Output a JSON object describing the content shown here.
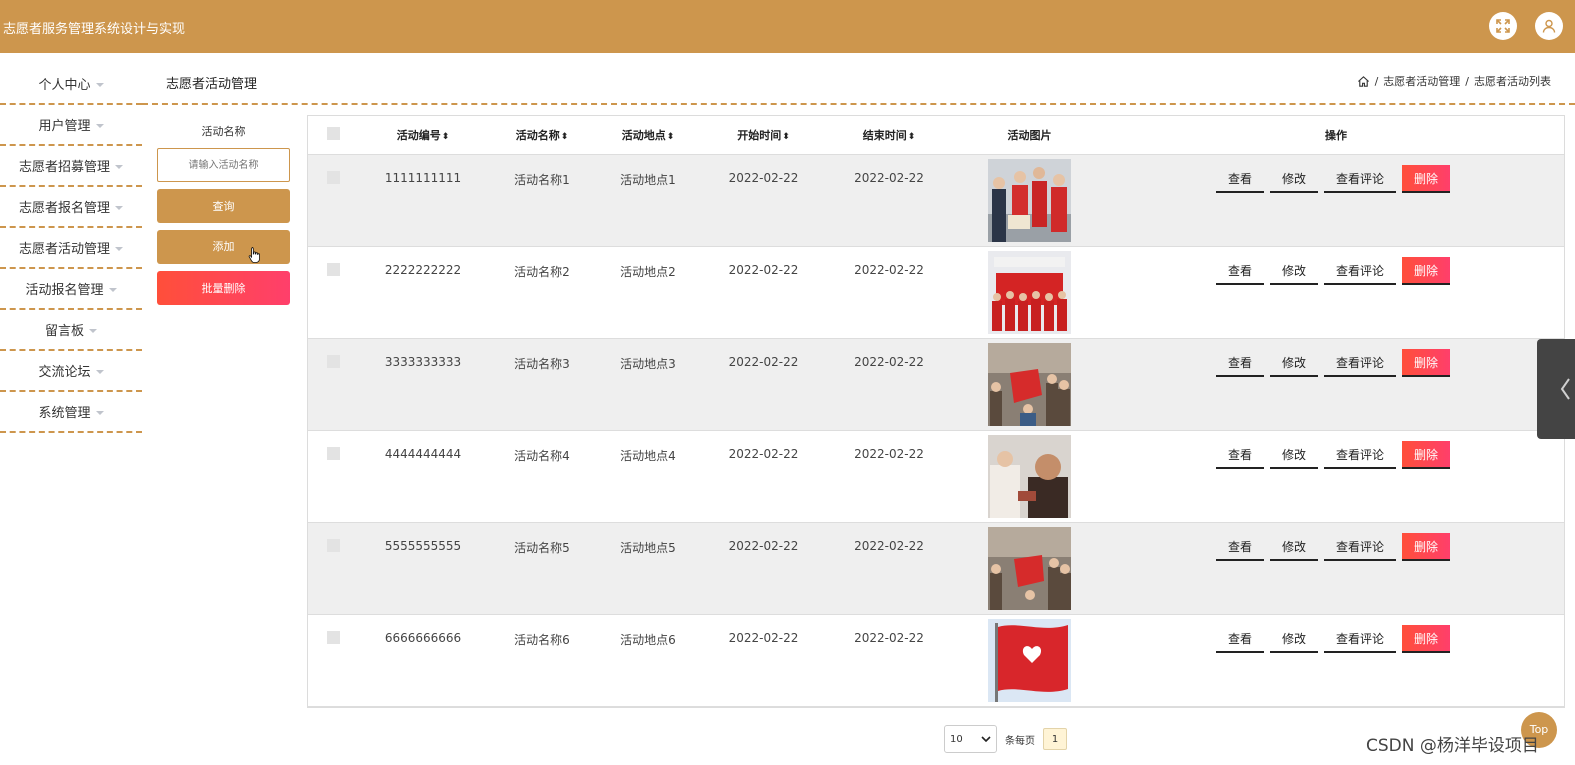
{
  "app": {
    "title": "志愿者服务管理系统设计与实现"
  },
  "sidebar": {
    "items": [
      {
        "label": "个人中心"
      },
      {
        "label": "用户管理"
      },
      {
        "label": "志愿者招募管理"
      },
      {
        "label": "志愿者报名管理"
      },
      {
        "label": "志愿者活动管理"
      },
      {
        "label": "活动报名管理"
      },
      {
        "label": "留言板"
      },
      {
        "label": "交流论坛"
      },
      {
        "label": "系统管理"
      }
    ]
  },
  "page": {
    "heading": "志愿者活动管理"
  },
  "breadcrumb": {
    "items": [
      "志愿者活动管理",
      "志愿者活动列表"
    ],
    "separator": "/"
  },
  "filter": {
    "label": "活动名称",
    "placeholder": "请输入活动名称",
    "query_label": "查询",
    "add_label": "添加",
    "batch_delete_label": "批量删除"
  },
  "table": {
    "headers": {
      "code": "活动编号",
      "name": "活动名称",
      "place": "活动地点",
      "start": "开始时间",
      "end": "结束时间",
      "image": "活动图片",
      "ops": "操作"
    },
    "sort_glyph": "⬍",
    "rows": [
      {
        "code": "1111111111",
        "name": "活动名称1",
        "place": "活动地点1",
        "start": "2022-02-22",
        "end": "2022-02-22"
      },
      {
        "code": "2222222222",
        "name": "活动名称2",
        "place": "活动地点2",
        "start": "2022-02-22",
        "end": "2022-02-22"
      },
      {
        "code": "3333333333",
        "name": "活动名称3",
        "place": "活动地点3",
        "start": "2022-02-22",
        "end": "2022-02-22"
      },
      {
        "code": "4444444444",
        "name": "活动名称4",
        "place": "活动地点4",
        "start": "2022-02-22",
        "end": "2022-02-22"
      },
      {
        "code": "5555555555",
        "name": "活动名称5",
        "place": "活动地点5",
        "start": "2022-02-22",
        "end": "2022-02-22"
      },
      {
        "code": "6666666666",
        "name": "活动名称6",
        "place": "活动地点6",
        "start": "2022-02-22",
        "end": "2022-02-22"
      }
    ],
    "ops": {
      "view": "查看",
      "edit": "修改",
      "comments": "查看评论",
      "delete": "删除"
    }
  },
  "pager": {
    "page_size": "10",
    "per_page_label": "条每页",
    "current_page": "1"
  },
  "back_to_top": {
    "label": "Top"
  },
  "watermark": "CSDN @杨洋毕设项目",
  "colors": {
    "accent": "#cd964d",
    "danger": "#ff4f3a"
  }
}
